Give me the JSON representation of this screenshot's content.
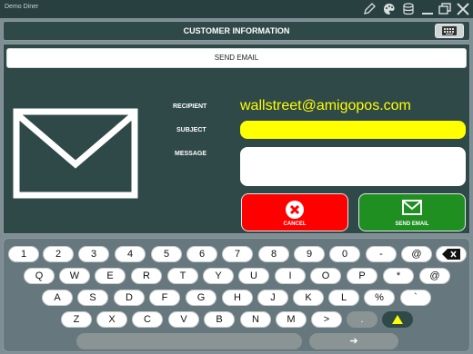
{
  "app_title": "Demo Diner",
  "header": {
    "title": "CUSTOMER INFORMATION"
  },
  "send_email_bar": "SEND EMAIL",
  "form": {
    "recipient_label": "RECIPIENT",
    "recipient_value": "wallstreet@amigopos.com",
    "subject_label": "SUBJECT",
    "subject_value": "",
    "message_label": "MESSAGE",
    "message_value": ""
  },
  "buttons": {
    "cancel": "CANCEL",
    "send": "SEND EMAIL"
  },
  "keyboard": {
    "row1": [
      "1",
      "2",
      "3",
      "4",
      "5",
      "6",
      "7",
      "8",
      "9",
      "0",
      "-",
      "@"
    ],
    "row2": [
      "Q",
      "W",
      "E",
      "R",
      "T",
      "Y",
      "U",
      "I",
      "O",
      "P",
      "*",
      "@"
    ],
    "row3": [
      "A",
      "S",
      "D",
      "F",
      "G",
      "H",
      "J",
      "K",
      "L",
      "%",
      "`"
    ],
    "row4": [
      "Z",
      "X",
      "C",
      "V",
      "B",
      "N",
      "M",
      ">",
      "."
    ],
    "enter_glyph": "➔"
  },
  "colors": {
    "panel": "#2f4948",
    "accent_yellow": "#ffff00",
    "cancel_red": "#ff0000",
    "send_green": "#1f8f22"
  },
  "icons": [
    "pencil-icon",
    "palette-icon",
    "database-icon",
    "minimize-icon",
    "restore-icon",
    "close-icon",
    "keyboard-icon",
    "envelope-icon",
    "cancel-x-icon",
    "send-envelope-icon",
    "backspace-icon",
    "shift-icon"
  ]
}
